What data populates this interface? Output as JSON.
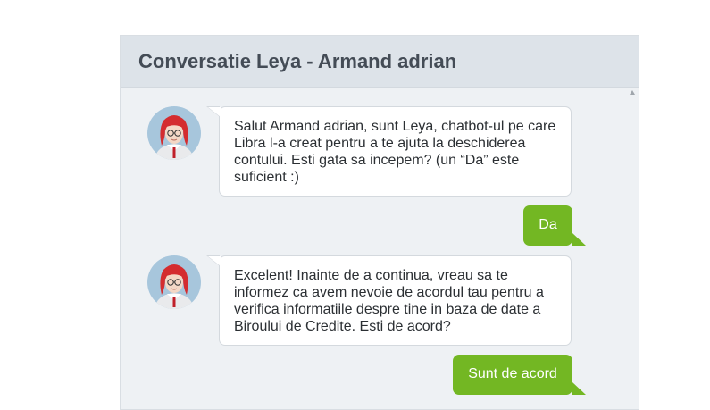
{
  "chat": {
    "title": "Conversatie Leya - Armand adrian",
    "messages": [
      {
        "sender": "bot",
        "text": "Salut Armand adrian, sunt Leya, chatbot-ul pe care Libra l-a creat pentru a te ajuta la deschiderea contului. Esti gata sa incepem? (un “Da” este suficient :)"
      },
      {
        "sender": "user",
        "text": "Da"
      },
      {
        "sender": "bot",
        "text": "Excelent! Inainte de a continua, vreau sa te informez ca avem nevoie de acordul tau pentru a verifica informatiile despre tine in baza de date a Biroului de Credite. Esti de acord?"
      },
      {
        "sender": "user",
        "text": "Sunt de acord"
      }
    ]
  },
  "colors": {
    "header_bg": "#dde3e9",
    "panel_bg": "#eef1f4",
    "user_bubble": "#73b723",
    "bot_bubble": "#ffffff",
    "avatar_bg": "#a7c6dc"
  },
  "icons": {
    "bot_avatar": "red-haired-woman-avatar-icon",
    "scroll": "scroll-up-arrow-icon"
  }
}
